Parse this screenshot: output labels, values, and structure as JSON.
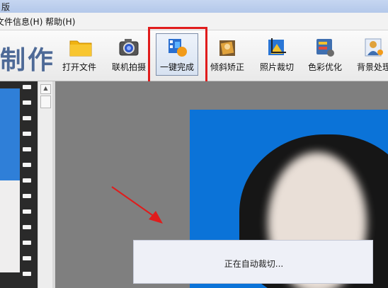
{
  "window": {
    "title_fragment": "版"
  },
  "menu": {
    "items": [
      {
        "label": "文件信息(H)"
      },
      {
        "label": "帮助(H)"
      }
    ]
  },
  "brand": {
    "text": "制作"
  },
  "toolbar": {
    "tools": [
      {
        "label": "打开文件",
        "icon": "folder-icon"
      },
      {
        "label": "联机拍摄",
        "icon": "camera-icon"
      },
      {
        "label": "一键完成",
        "icon": "one-click-icon",
        "active": true
      },
      {
        "label": "倾斜矫正",
        "icon": "tilt-correct-icon"
      },
      {
        "label": "照片裁切",
        "icon": "crop-icon"
      },
      {
        "label": "色彩优化",
        "icon": "color-optimize-icon"
      },
      {
        "label": "背景处理",
        "icon": "background-icon"
      }
    ]
  },
  "dialog": {
    "message": "正在自动裁切..."
  },
  "colors": {
    "highlight": "#e01c1c",
    "photo_background": "#0b73d8",
    "brand": "#4e6a97"
  }
}
